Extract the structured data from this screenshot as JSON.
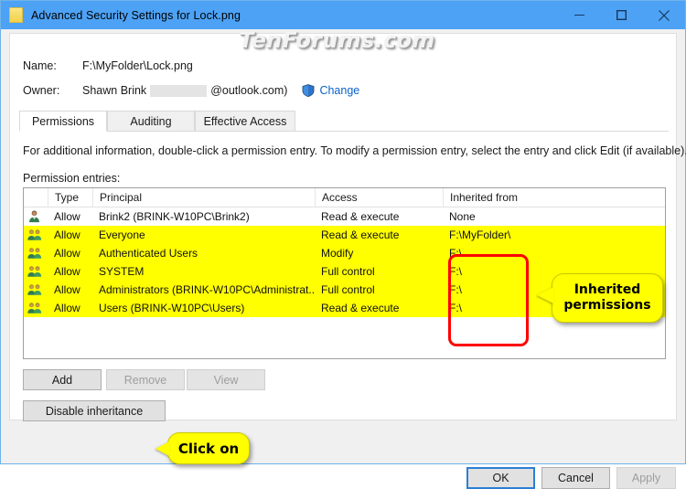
{
  "window": {
    "title": "Advanced Security Settings for Lock.png",
    "icon": "file-icon",
    "minimize": "─",
    "maximize": "□",
    "close": "✕"
  },
  "watermark": "TenForums.com",
  "header": {
    "name_label": "Name:",
    "name_value": "F:\\MyFolder\\Lock.png",
    "owner_label": "Owner:",
    "owner_name": "Shawn Brink",
    "owner_domain": "@outlook.com)",
    "change_link": "Change",
    "shield_icon": "uac-shield-icon"
  },
  "tabs": [
    {
      "label": "Permissions",
      "active": true
    },
    {
      "label": "Auditing",
      "active": false
    },
    {
      "label": "Effective Access",
      "active": false
    }
  ],
  "instruction": "For additional information, double-click a permission entry. To modify a permission entry, select the entry and click Edit (if available).",
  "entries_label": "Permission entries:",
  "list": {
    "columns": [
      "",
      "Type",
      "Principal",
      "Access",
      "Inherited from"
    ],
    "rows": [
      {
        "icon": "user-icon",
        "type": "Allow",
        "principal": "Brink2 (BRINK-W10PC\\Brink2)",
        "access": "Read & execute",
        "inherited": "None",
        "highlighted": false
      },
      {
        "icon": "group-icon",
        "type": "Allow",
        "principal": "Everyone",
        "access": "Read & execute",
        "inherited": "F:\\MyFolder\\",
        "highlighted": true
      },
      {
        "icon": "group-icon",
        "type": "Allow",
        "principal": "Authenticated Users",
        "access": "Modify",
        "inherited": "F:\\",
        "highlighted": true
      },
      {
        "icon": "group-icon",
        "type": "Allow",
        "principal": "SYSTEM",
        "access": "Full control",
        "inherited": "F:\\",
        "highlighted": true
      },
      {
        "icon": "group-icon",
        "type": "Allow",
        "principal": "Administrators (BRINK-W10PC\\Administrat...",
        "access": "Full control",
        "inherited": "F:\\",
        "highlighted": true
      },
      {
        "icon": "group-icon",
        "type": "Allow",
        "principal": "Users (BRINK-W10PC\\Users)",
        "access": "Read & execute",
        "inherited": "F:\\",
        "highlighted": true
      }
    ]
  },
  "annotations": {
    "inherited_callout": "Inherited permissions",
    "click_callout": "Click on",
    "highlight_color": "#ff0000",
    "callout_color": "#ffff00"
  },
  "buttons": {
    "add": "Add",
    "remove": "Remove",
    "view": "View",
    "disable_inheritance": "Disable inheritance",
    "ok": "OK",
    "cancel": "Cancel",
    "apply": "Apply"
  }
}
